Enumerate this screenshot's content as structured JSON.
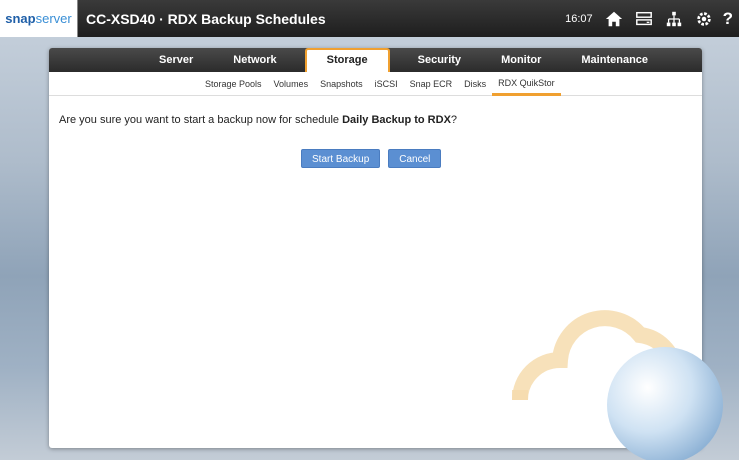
{
  "header": {
    "logo_snap": "snap",
    "logo_server": "server",
    "title": "CC-XSD40 · RDX Backup Schedules",
    "clock": "16:07",
    "icons": [
      "home-icon",
      "storage-icon",
      "network-icon",
      "settings-icon",
      "help-icon"
    ],
    "help_label": "?"
  },
  "nav": {
    "tabs": [
      {
        "label": "Server"
      },
      {
        "label": "Network"
      },
      {
        "label": "Storage"
      },
      {
        "label": "Security"
      },
      {
        "label": "Monitor"
      },
      {
        "label": "Maintenance"
      }
    ]
  },
  "subnav": {
    "tabs": [
      {
        "label": "Storage Pools"
      },
      {
        "label": "Volumes"
      },
      {
        "label": "Snapshots"
      },
      {
        "label": "iSCSI"
      },
      {
        "label": "Snap ECR"
      },
      {
        "label": "Disks"
      },
      {
        "label": "RDX QuikStor"
      }
    ]
  },
  "dialog": {
    "prefix": "Are you sure you want to start a backup now for schedule ",
    "schedule_name": "Daily Backup to RDX",
    "suffix": "?",
    "start_label": "Start Backup",
    "cancel_label": "Cancel"
  },
  "colors": {
    "accent": "#f0a030",
    "button": "#5b8fd2",
    "topbar": "#2a2a2a"
  }
}
